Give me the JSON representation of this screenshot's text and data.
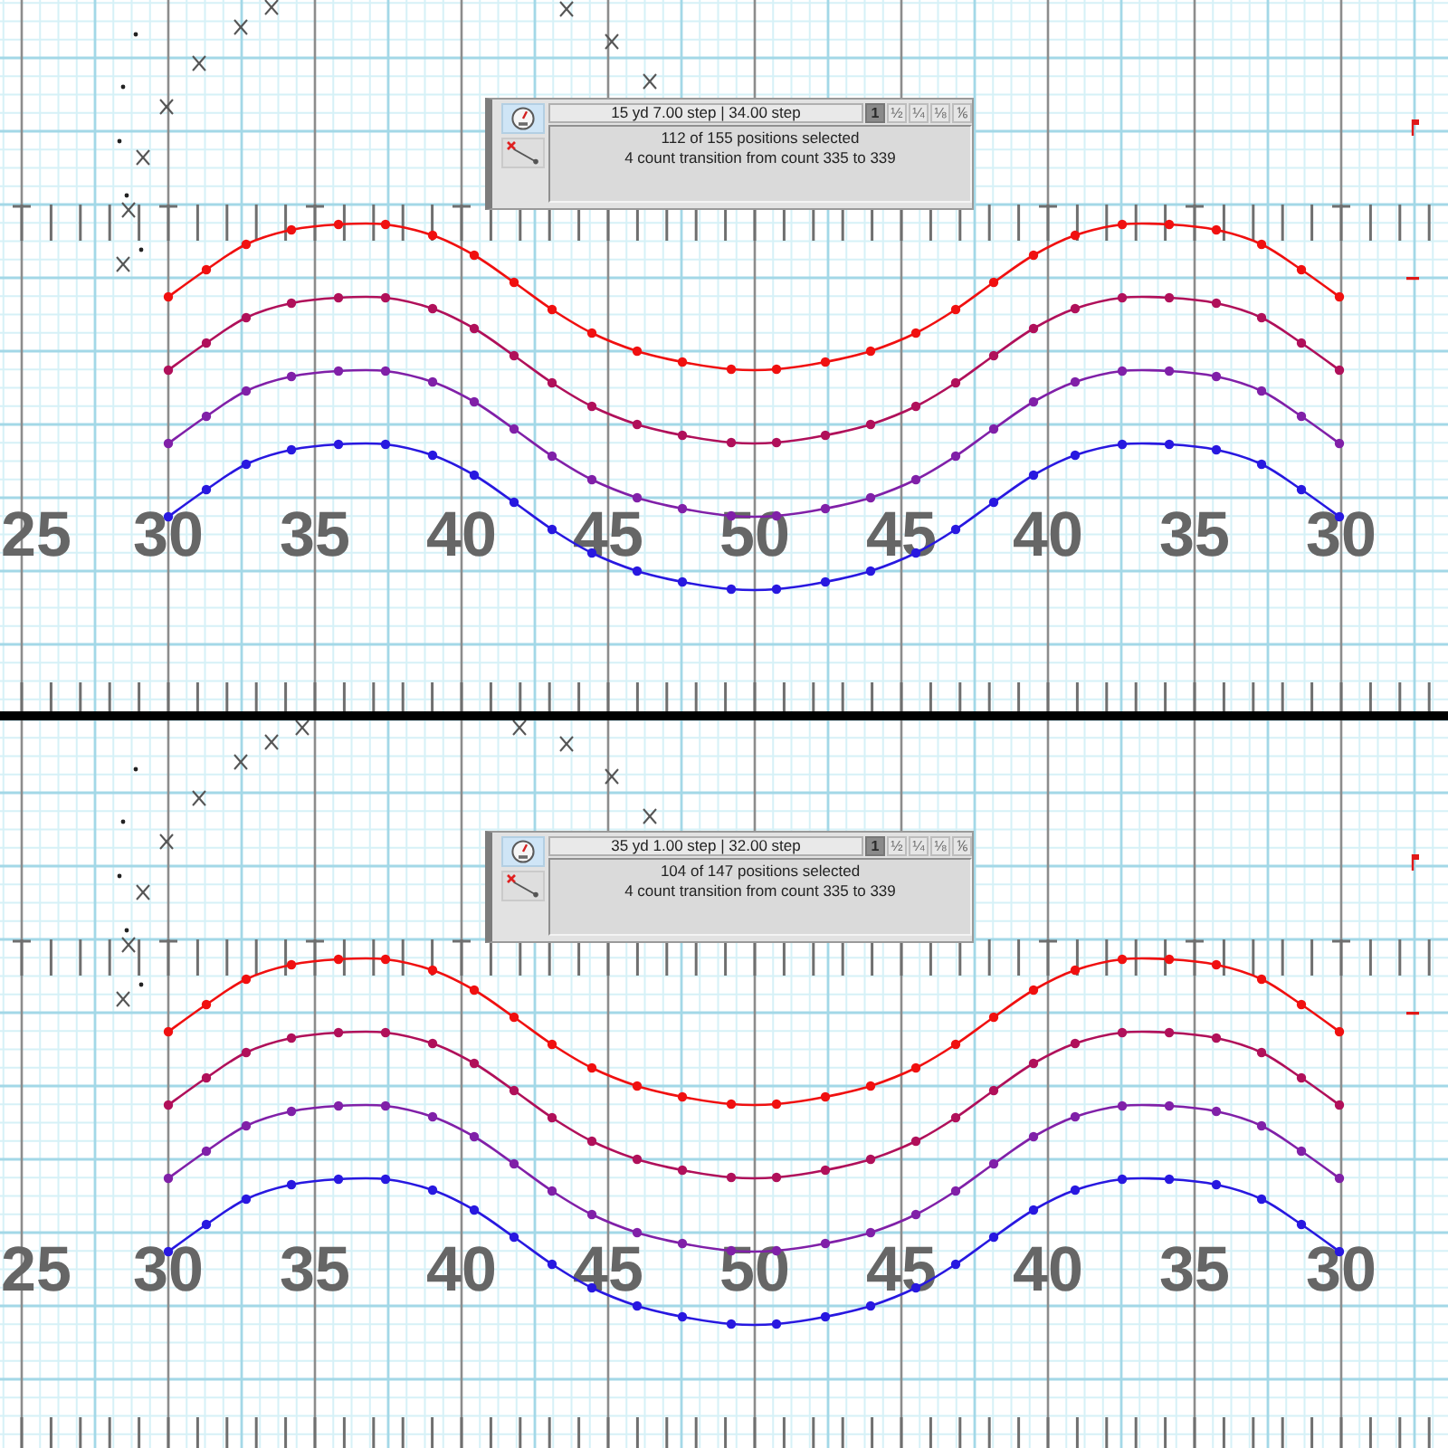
{
  "panes": [
    {
      "info_panel": {
        "tools": [
          {
            "kind": "gauge",
            "selected": true
          },
          {
            "kind": "path",
            "selected": false
          }
        ],
        "readout": "15 yd 7.00 step | 34.00 step",
        "step_sizes": [
          {
            "label": "1",
            "selected": true
          },
          {
            "label": "½",
            "selected": false
          },
          {
            "label": "¼",
            "selected": false
          },
          {
            "label": "⅛",
            "selected": false
          },
          {
            "label": "⅙",
            "selected": false
          }
        ],
        "messages": [
          "112 of 155 positions selected",
          "4 count transition from count 335 to 339"
        ]
      },
      "field": {
        "yard_numbers": [
          "25",
          "30",
          "35",
          "40",
          "45",
          "50",
          "45",
          "40",
          "35",
          "30"
        ],
        "forms": [
          {
            "color": "#f01010"
          },
          {
            "color": "#b0105a"
          },
          {
            "color": "#8020a8"
          },
          {
            "color": "#2818e0"
          }
        ]
      }
    },
    {
      "info_panel": {
        "tools": [
          {
            "kind": "gauge",
            "selected": true
          },
          {
            "kind": "path",
            "selected": false
          }
        ],
        "readout": "35 yd 1.00 step | 32.00 step",
        "step_sizes": [
          {
            "label": "1",
            "selected": true
          },
          {
            "label": "½",
            "selected": false
          },
          {
            "label": "¼",
            "selected": false
          },
          {
            "label": "⅛",
            "selected": false
          },
          {
            "label": "⅙",
            "selected": false
          }
        ],
        "messages": [
          "104 of 147 positions selected",
          "4 count transition from count 335 to 339"
        ]
      },
      "field": {
        "yard_numbers": [
          "25",
          "30",
          "35",
          "40",
          "45",
          "50",
          "45",
          "40",
          "35",
          "30"
        ],
        "forms": [
          {
            "color": "#f01010"
          },
          {
            "color": "#b0105a"
          },
          {
            "color": "#8020a8"
          },
          {
            "color": "#2818e0"
          }
        ]
      }
    }
  ]
}
